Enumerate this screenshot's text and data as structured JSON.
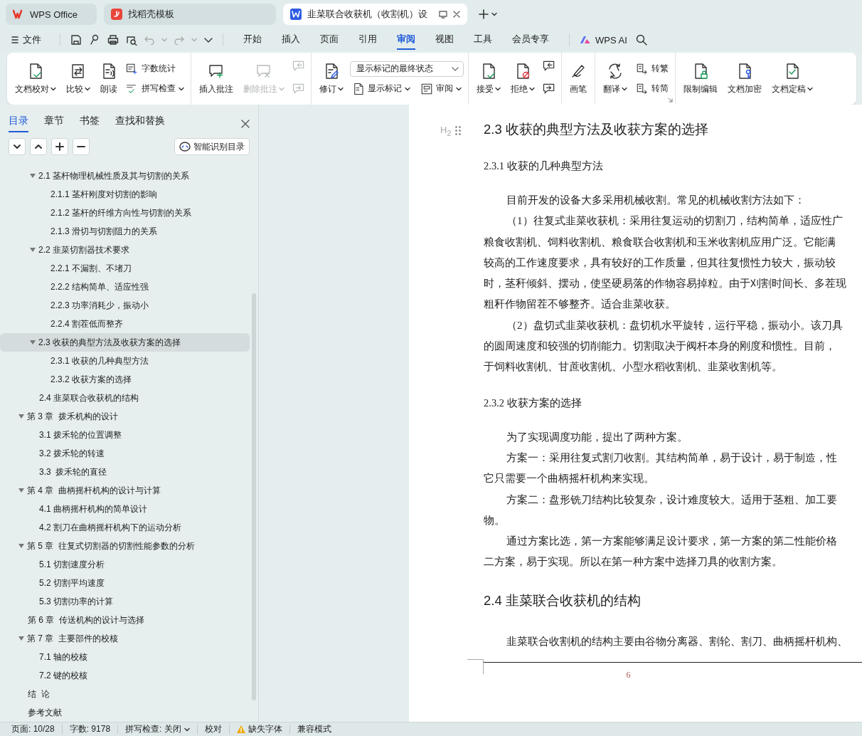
{
  "tabs": [
    {
      "label": "WPS Office",
      "kind": "home",
      "selected": false
    },
    {
      "label": "找稻壳模板",
      "kind": "template",
      "selected": false
    },
    {
      "label": "韭菜联合收获机（收割机）设",
      "kind": "document",
      "selected": true
    }
  ],
  "menu": {
    "file": "文件",
    "tabs": [
      {
        "label": "开始",
        "selected": false
      },
      {
        "label": "插入",
        "selected": false
      },
      {
        "label": "页面",
        "selected": false
      },
      {
        "label": "引用",
        "selected": false
      },
      {
        "label": "审阅",
        "selected": true
      },
      {
        "label": "视图",
        "selected": false
      },
      {
        "label": "工具",
        "selected": false
      },
      {
        "label": "会员专享",
        "selected": false
      }
    ],
    "ai": "WPS AI"
  },
  "ribbon": {
    "groups": [
      {
        "columns": [
          [
            [
              {
                "kind": "large",
                "label": "文档校对",
                "caret": true,
                "disabled": false
              }
            ]
          ],
          [
            [
              {
                "kind": "large",
                "label": "比较",
                "caret": true,
                "disabled": false
              }
            ]
          ],
          [
            [
              {
                "kind": "large",
                "label": "朗读",
                "caret": false,
                "disabled": false
              }
            ]
          ],
          [
            [
              {
                "kind": "small",
                "label": "字数统计",
                "caret": false,
                "disabled": false
              }
            ],
            [
              {
                "kind": "small",
                "label": "拼写检查",
                "caret": true,
                "disabled": false
              }
            ]
          ]
        ]
      },
      {
        "columns": [
          [
            [
              {
                "kind": "large",
                "label": "插入批注",
                "caret": false,
                "disabled": false
              }
            ]
          ],
          [
            [
              {
                "kind": "large",
                "label": "删除批注",
                "caret": true,
                "disabled": true
              }
            ]
          ],
          [
            [
              {
                "kind": "icon",
                "disabled": true
              }
            ],
            [
              {
                "kind": "icon",
                "disabled": true
              }
            ]
          ]
        ]
      },
      {
        "columns": [
          [
            [
              {
                "kind": "large",
                "label": "修订",
                "caret": true,
                "disabled": false
              }
            ]
          ],
          [
            [
              {
                "kind": "dropdown",
                "label": "显示标记的最终状态",
                "disabled": false
              }
            ],
            [
              {
                "kind": "small",
                "label": "显示标记",
                "caret": true,
                "disabled": false
              },
              {
                "kind": "small",
                "label": "审阅",
                "caret": true,
                "disabled": false
              }
            ]
          ]
        ]
      },
      {
        "columns": [
          [
            [
              {
                "kind": "large",
                "label": "接受",
                "caret": true,
                "disabled": false
              }
            ]
          ],
          [
            [
              {
                "kind": "large",
                "label": "拒绝",
                "caret": true,
                "disabled": false
              }
            ]
          ],
          [
            [
              {
                "kind": "icon",
                "disabled": false
              }
            ],
            [
              {
                "kind": "icon",
                "disabled": false
              }
            ]
          ]
        ]
      },
      {
        "columns": [
          [
            [
              {
                "kind": "large",
                "label": "画笔",
                "caret": false,
                "disabled": false
              }
            ]
          ]
        ]
      },
      {
        "columns": [
          [
            [
              {
                "kind": "large",
                "label": "翻译",
                "caret": true,
                "disabled": false
              }
            ]
          ],
          [
            [
              {
                "kind": "small",
                "label": "转繁",
                "caret": false,
                "disabled": false
              }
            ],
            [
              {
                "kind": "small",
                "label": "转简",
                "caret": false,
                "disabled": false
              }
            ]
          ]
        ],
        "launcher": true
      },
      {
        "columns": [
          [
            [
              {
                "kind": "large",
                "label": "限制编辑",
                "caret": false,
                "disabled": false
              }
            ]
          ],
          [
            [
              {
                "kind": "large",
                "label": "文档加密",
                "caret": false,
                "disabled": false
              }
            ]
          ],
          [
            [
              {
                "kind": "large",
                "label": "文档定稿",
                "caret": true,
                "disabled": false
              }
            ]
          ]
        ]
      }
    ]
  },
  "sidebar": {
    "tabs": [
      {
        "label": "目录",
        "selected": true
      },
      {
        "label": "章节",
        "selected": false
      },
      {
        "label": "书签",
        "selected": false
      },
      {
        "label": "查找和替换",
        "selected": false
      }
    ],
    "smart_toc": "智能识别目录",
    "sections": [
      {
        "label": "2.1 茎杆物理机械性质及其与切割的关系",
        "expanded": true,
        "selected": false,
        "children": [
          {
            "label": "2.1.1 茎杆刚度对切割的影响",
            "selected": false
          },
          {
            "label": "2.1.2 茎杆的纤维方向性与切割的关系",
            "selected": false
          },
          {
            "label": "2.1.3 滑切与切割阻力的关系",
            "selected": false
          }
        ]
      },
      {
        "label": "2.2 韭菜切割器技术要求",
        "expanded": true,
        "selected": false,
        "children": [
          {
            "label": "2.2.1 不漏割、不堵刀",
            "selected": false
          },
          {
            "label": "2.2.2 结构简单、适应性强",
            "selected": false
          },
          {
            "label": "2.2.3 功率消耗少，振动小",
            "selected": false
          },
          {
            "label": "2.2.4 割茬低而整齐",
            "selected": false
          }
        ]
      },
      {
        "label": "2.3 收获的典型方法及收获方案的选择",
        "expanded": true,
        "selected": true,
        "children": [
          {
            "label": "2.3.1 收获的几种典型方法",
            "selected": false
          },
          {
            "label": "2.3.2 收获方案的选择",
            "selected": false
          }
        ]
      },
      {
        "label": "2.4 韭菜联合收获机的结构",
        "selected": false
      }
    ],
    "chapters": [
      {
        "label": "第 3 章  拨禾机构的设计",
        "expanded": true,
        "selected": false,
        "children": [
          {
            "label": "3.1 拨禾轮的位置调整",
            "selected": false
          },
          {
            "label": "3.2 拨禾轮的转速",
            "selected": false
          },
          {
            "label": "3.3  拨禾轮的直径",
            "selected": false
          }
        ]
      },
      {
        "label": "第 4 章  曲柄摇杆机构的设计与计算",
        "expanded": true,
        "selected": false,
        "children": [
          {
            "label": "4.1 曲柄摇杆机构的简单设计",
            "selected": false
          },
          {
            "label": "4.2 割刀在曲柄摇杆机构下的运动分析",
            "selected": false
          }
        ]
      },
      {
        "label": "第 5 章  往复式切割器的切割性能参数的分析",
        "expanded": true,
        "selected": false,
        "children": [
          {
            "label": "5.1 切割速度分析",
            "selected": false
          },
          {
            "label": "5.2 切割平均速度",
            "selected": false
          },
          {
            "label": "5.3 切割功率的计算",
            "selected": false
          }
        ]
      },
      {
        "label": "第 6 章  传送机构的设计与选择",
        "selected": false
      },
      {
        "label": "第 7 章  主要部件的校核",
        "expanded": true,
        "selected": false,
        "children": [
          {
            "label": "7.1 轴的校核",
            "selected": false
          },
          {
            "label": "7.2 键的校核",
            "selected": false
          }
        ]
      },
      {
        "label": "结  论",
        "selected": false
      },
      {
        "label": "参考文献",
        "selected": false
      }
    ]
  },
  "document": {
    "heading_marker": "H$_{2}$",
    "blocks": [
      {
        "kind": "h2",
        "lines": [
          "2.3 收获的典型方法及收获方案的选择"
        ]
      },
      {
        "kind": "h3",
        "lines": [
          "2.3.1 收获的几种典型方法"
        ]
      },
      {
        "kind": "para",
        "lines": [
          "目前开发的设备大多采用机械收割。常见的机械收割方法如下："
        ]
      },
      {
        "kind": "para",
        "lines": [
          "（1）往复式韭菜收获机：采用往复运动的切割刀，结构简单，适应性广",
          "粮食收割机、饲料收割机、粮食联合收割机和玉米收割机应用广泛。它能满",
          "较高的工作速度要求，具有较好的工作质量，但其往复惯性力较大，振动较",
          "时，茎秆倾斜、摆动，使坚硬易落的作物容易掉粒。由于刈割时间长、多茬现",
          "粗秆作物留茬不够整齐。适合韭菜收获。"
        ]
      },
      {
        "kind": "para",
        "lines": [
          "（2）盘切式韭菜收获机：盘切机水平旋转，运行平稳，振动小。该刀具",
          "的圆周速度和较强的切削能力。切割取决于阀杆本身的刚度和惯性。目前，",
          "于饲料收割机、甘蔗收割机、小型水稻收割机、韭菜收割机等。"
        ]
      },
      {
        "kind": "h3",
        "lines": [
          "2.3.2 收获方案的选择"
        ]
      },
      {
        "kind": "para",
        "lines": [
          "为了实现调度功能，提出了两种方案。"
        ]
      },
      {
        "kind": "para",
        "lines": [
          "方案一：采用往复式割刀收割。其结构简单，易于设计，易于制造，性",
          "它只需要一个曲柄摇杆机构来实现。"
        ]
      },
      {
        "kind": "para",
        "lines": [
          "方案二：盘形铣刀结构比较复杂，设计难度较大。适用于茎粗、加工要",
          "物。"
        ]
      },
      {
        "kind": "para",
        "lines": [
          "通过方案比选，第一方案能够满足设计要求，第一方案的第二性能价格",
          "二方案，易于实现。所以在第一种方案中选择刀具的收割方案。"
        ]
      },
      {
        "kind": "h2",
        "lines": [
          "2.4 韭菜联合收获机的结构"
        ]
      },
      {
        "kind": "para",
        "lines": [
          "韭菜联合收割机的结构主要由谷物分离器、割轮、割刀、曲柄摇杆机构、"
        ]
      }
    ],
    "page_number": "6"
  },
  "status_bar": [
    {
      "kind": "text",
      "label": "页面: 10/28"
    },
    {
      "kind": "text",
      "label": "字数: 9178"
    },
    {
      "kind": "dropdown",
      "label": "拼写检查: 关闭"
    },
    {
      "kind": "text",
      "label": "校对"
    },
    {
      "kind": "warning",
      "label": "缺失字体"
    },
    {
      "kind": "text",
      "label": "兼容模式"
    }
  ]
}
